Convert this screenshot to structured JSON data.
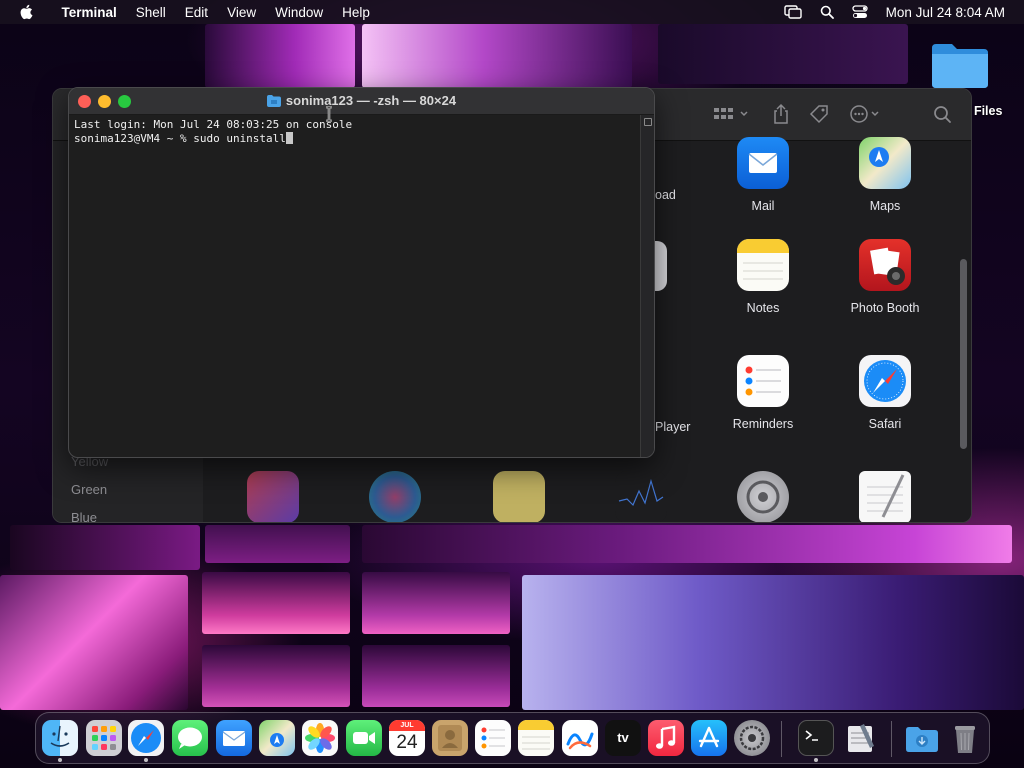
{
  "menubar": {
    "app_name": "Terminal",
    "items": [
      "Shell",
      "Edit",
      "View",
      "Window",
      "Help"
    ],
    "clock": "Mon Jul 24  8:04 AM"
  },
  "desktop": {
    "folder_label": "l Files"
  },
  "terminal": {
    "title": "sonima123 — -zsh — 80×24",
    "lines": [
      "Last login: Mon Jul 24 08:03:25 on console",
      "sonima123@VM4 ~ % sudo uninstall"
    ]
  },
  "background_window": {
    "sidebar_tags": [
      "Yellow",
      "Green",
      "Blue"
    ],
    "partial_labels": [
      "oad",
      "Player"
    ],
    "apps": [
      {
        "label": "Mail",
        "icon": "mail-icon"
      },
      {
        "label": "Maps",
        "icon": "maps-icon"
      },
      {
        "label": "Notes",
        "icon": "notes-icon"
      },
      {
        "label": "Photo Booth",
        "icon": "photo-booth-icon"
      },
      {
        "label": "Reminders",
        "icon": "reminders-icon"
      },
      {
        "label": "Safari",
        "icon": "safari-icon"
      }
    ],
    "bottom_row_icons": [
      "shortcuts-icon",
      "siri-icon",
      "stickies-icon",
      "stocks-icon",
      "system-settings-icon",
      "textedit-icon"
    ]
  },
  "dock": {
    "items": [
      "finder-icon",
      "launchpad-icon",
      "safari-icon",
      "messages-icon",
      "mail-icon",
      "maps-icon",
      "photos-icon",
      "facetime-icon",
      "calendar-icon",
      "contacts-icon",
      "reminders-icon",
      "notes-icon",
      "freeform-icon",
      "apple-tv-icon",
      "music-icon",
      "app-store-icon",
      "system-settings-icon",
      "terminal-icon",
      "script-editor-icon",
      "downloads-folder-icon",
      "trash-icon"
    ],
    "calendar_month": "JUL",
    "calendar_day": "24",
    "tv_label": "tv"
  },
  "colors": {
    "close": "#fe5f57",
    "minimize": "#febc2e",
    "maximize": "#28c840",
    "terminal_bg": "#1e1e1e"
  }
}
